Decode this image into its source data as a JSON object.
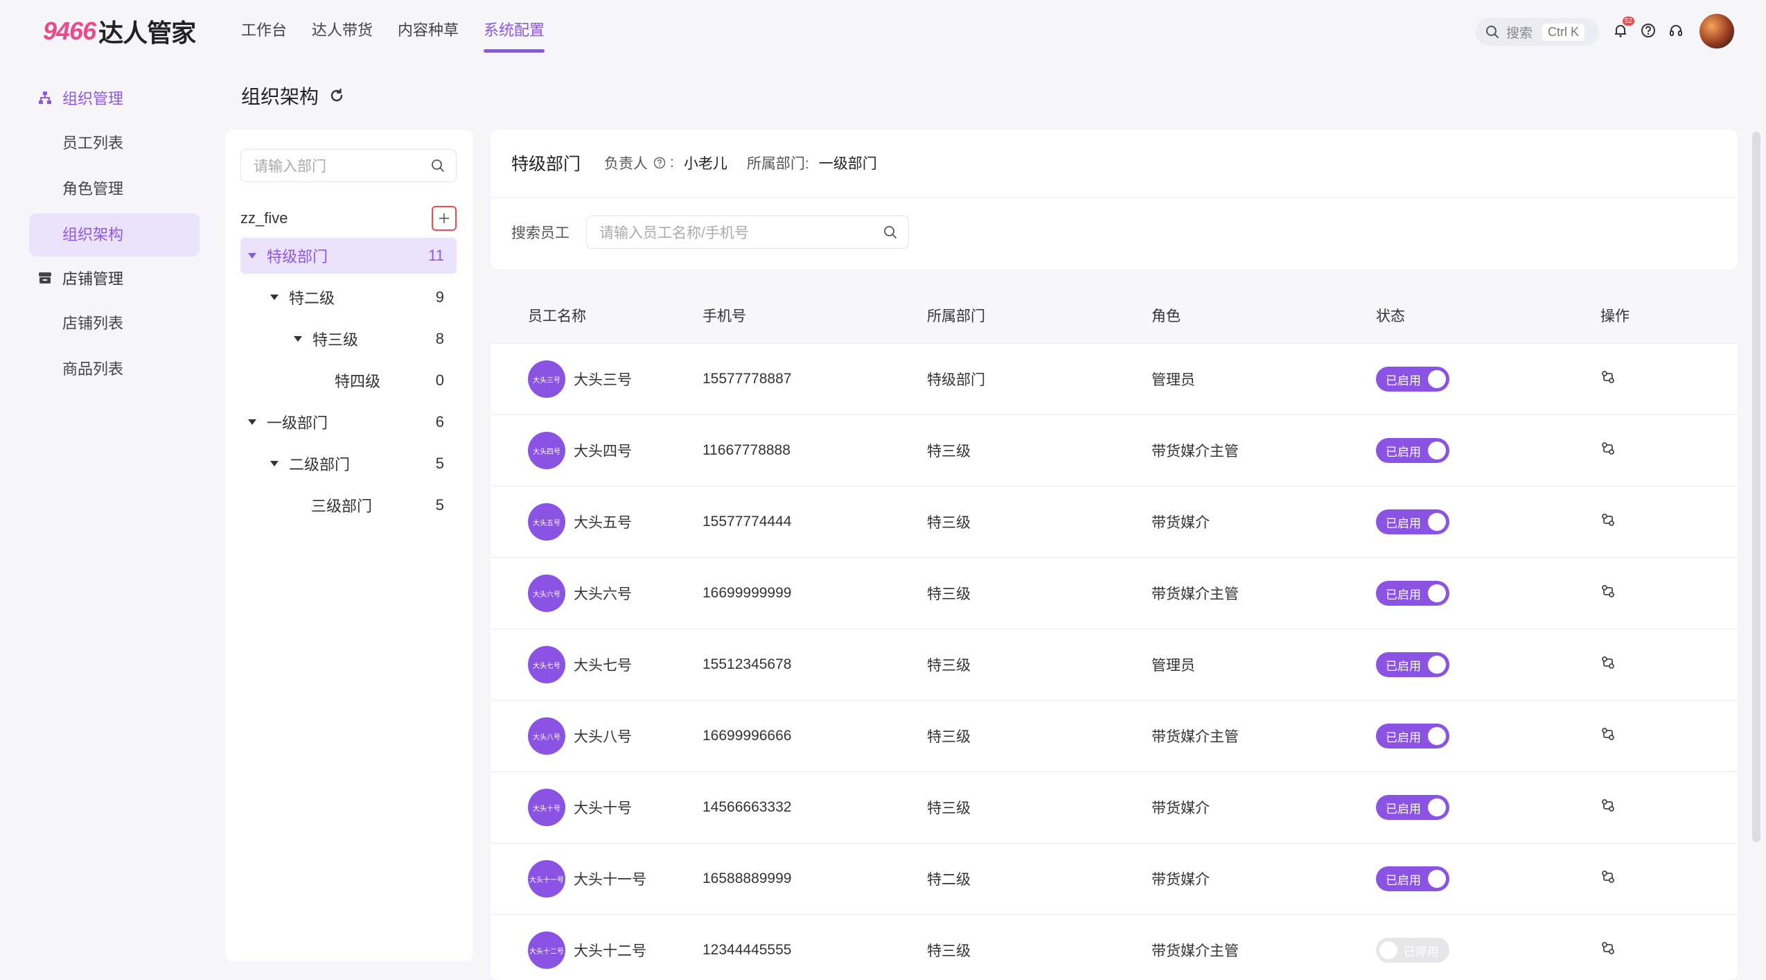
{
  "brand": {
    "num": "9466",
    "text": "达人管家"
  },
  "topnav": [
    "工作台",
    "达人带货",
    "内容种草",
    "系统配置"
  ],
  "search": {
    "label": "搜索",
    "shortcut": "Ctrl K"
  },
  "notifications": {
    "count": "52"
  },
  "sidebar": {
    "group1": "组织管理",
    "items1": [
      "员工列表",
      "角色管理",
      "组织架构"
    ],
    "group2": "店铺管理",
    "items2": [
      "店铺列表",
      "商品列表"
    ]
  },
  "page": {
    "title": "组织架构"
  },
  "tree": {
    "search_placeholder": "请输入部门",
    "root": "zz_five",
    "nodes": [
      {
        "label": "特级部门",
        "count": "11"
      },
      {
        "label": "特二级",
        "count": "9"
      },
      {
        "label": "特三级",
        "count": "8"
      },
      {
        "label": "特四级",
        "count": "0"
      },
      {
        "label": "一级部门",
        "count": "6"
      },
      {
        "label": "二级部门",
        "count": "5"
      },
      {
        "label": "三级部门",
        "count": "5"
      }
    ]
  },
  "dept": {
    "name": "特级部门",
    "manager_label": "负责人",
    "manager": "小老儿",
    "parent_label": "所属部门:",
    "parent": "一级部门",
    "search_label": "搜索员工",
    "search_placeholder": "请输入员工名称/手机号"
  },
  "table": {
    "headers": [
      "员工名称",
      "手机号",
      "所属部门",
      "角色",
      "状态",
      "操作"
    ],
    "rows": [
      {
        "name": "大头三号",
        "phone": "15577778887",
        "dept": "特级部门",
        "role": "管理员",
        "status": "已启用"
      },
      {
        "name": "大头四号",
        "phone": "11667778888",
        "dept": "特三级",
        "role": "带货媒介主管",
        "status": "已启用"
      },
      {
        "name": "大头五号",
        "phone": "15577774444",
        "dept": "特三级",
        "role": "带货媒介",
        "status": "已启用"
      },
      {
        "name": "大头六号",
        "phone": "16699999999",
        "dept": "特三级",
        "role": "带货媒介主管",
        "status": "已启用"
      },
      {
        "name": "大头七号",
        "phone": "15512345678",
        "dept": "特三级",
        "role": "管理员",
        "status": "已启用"
      },
      {
        "name": "大头八号",
        "phone": "16699996666",
        "dept": "特三级",
        "role": "带货媒介主管",
        "status": "已启用"
      },
      {
        "name": "大头十号",
        "phone": "14566663332",
        "dept": "特三级",
        "role": "带货媒介",
        "status": "已启用"
      },
      {
        "name": "大头十一号",
        "phone": "16588889999",
        "dept": "特二级",
        "role": "带货媒介",
        "status": "已启用"
      },
      {
        "name": "大头十二号",
        "phone": "12344445555",
        "dept": "特三级",
        "role": "带货媒介主管",
        "status": "已停用"
      }
    ]
  },
  "colors": {
    "accent": "#8f56e6",
    "toggle_on": "#8b53e3",
    "toggle_off": "#e6e6ea",
    "add_border": "#ea4d4d"
  }
}
